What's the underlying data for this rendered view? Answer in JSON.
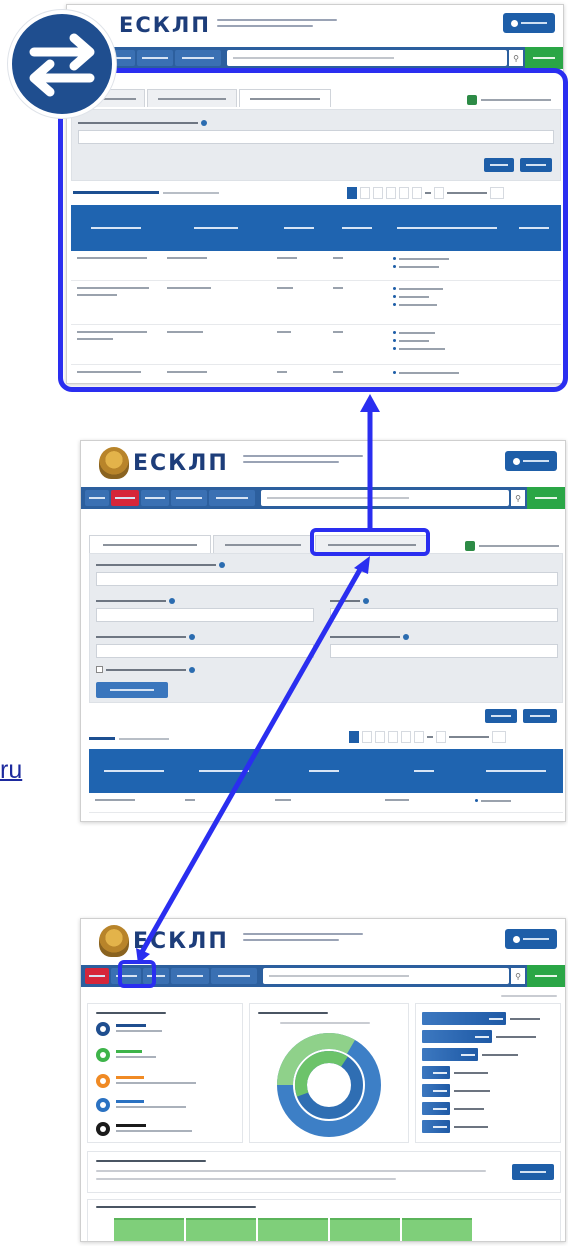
{
  "link": {
    "text": "ru"
  },
  "icons": {
    "swap": "swap-arrows-icon"
  },
  "colors": {
    "highlight": "#2a2ef0",
    "brand_blue": "#1f4e8f",
    "nav_blue": "#2c5f9e",
    "nav_red": "#d6263a",
    "nav_green": "#2aa646"
  },
  "screens": [
    {
      "name": "zoomed-results-tab",
      "active_tab_index": 2
    },
    {
      "name": "search-form",
      "active_tab_index": 0
    },
    {
      "name": "dashboard-home"
    }
  ]
}
